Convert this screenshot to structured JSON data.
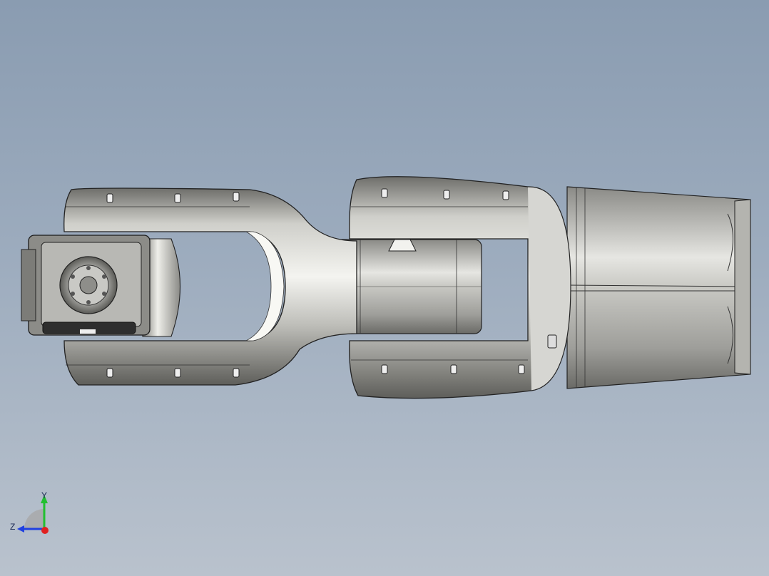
{
  "viewport": {
    "background_top": "#8a9cb1",
    "background_bottom": "#b9c2cd"
  },
  "model": {
    "icon": "robot-arm-model",
    "body_color": "#c9c9c4",
    "edge_color": "#1e1e1e"
  },
  "triad": {
    "x_color": "#e02020",
    "y_color": "#22c030",
    "z_color": "#2040e0",
    "y_label": "Y",
    "z_label": "Z"
  }
}
